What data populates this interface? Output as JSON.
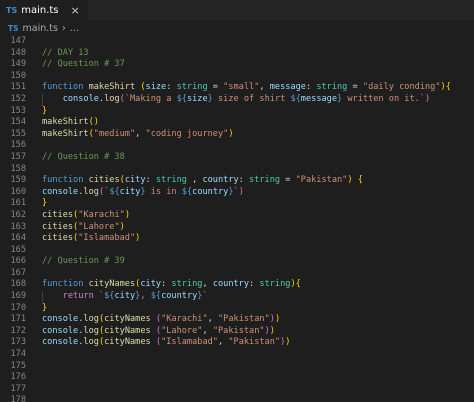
{
  "tab": {
    "icon_text": "TS",
    "filename": "main.ts",
    "close_glyph": "×"
  },
  "breadcrumb": {
    "icon_text": "TS",
    "file": "main.ts",
    "separator": "›",
    "more": "..."
  },
  "colors": {
    "keyword": "#569cd6",
    "function": "#dcdcaa",
    "param": "#9cdcfe",
    "type": "#4ec9b0",
    "string": "#ce9178",
    "comment": "#6a9955",
    "brace_gold": "#ffd700",
    "brace_pink": "#da70d6",
    "brace_blue": "#179fff",
    "plain": "#d4d4d4",
    "control": "#c586c0",
    "punct": "#d4d4d4"
  },
  "lines": [
    {
      "num": "147",
      "tokens": []
    },
    {
      "num": "148",
      "tokens": [
        {
          "t": "// DAY 13",
          "c": "comment"
        }
      ]
    },
    {
      "num": "149",
      "tokens": [
        {
          "t": "// Question # 37",
          "c": "comment"
        }
      ]
    },
    {
      "num": "150",
      "tokens": []
    },
    {
      "num": "151",
      "tokens": [
        {
          "t": "function ",
          "c": "keyword"
        },
        {
          "t": "makeShirt ",
          "c": "function"
        },
        {
          "t": "(",
          "c": "brace_gold"
        },
        {
          "t": "size",
          "c": "param"
        },
        {
          "t": ": ",
          "c": "plain"
        },
        {
          "t": "string",
          "c": "type"
        },
        {
          "t": " = ",
          "c": "plain"
        },
        {
          "t": "\"small\"",
          "c": "string"
        },
        {
          "t": ", ",
          "c": "plain"
        },
        {
          "t": "message",
          "c": "param"
        },
        {
          "t": ": ",
          "c": "plain"
        },
        {
          "t": "string",
          "c": "type"
        },
        {
          "t": " = ",
          "c": "plain"
        },
        {
          "t": "\"daily conding\"",
          "c": "string"
        },
        {
          "t": ")",
          "c": "brace_gold"
        },
        {
          "t": "{",
          "c": "brace_gold"
        }
      ]
    },
    {
      "num": "152",
      "indent": true,
      "tokens": [
        {
          "t": "    console",
          "c": "param"
        },
        {
          "t": ".",
          "c": "plain"
        },
        {
          "t": "log",
          "c": "function"
        },
        {
          "t": "(",
          "c": "brace_pink"
        },
        {
          "t": "`Making a ",
          "c": "string"
        },
        {
          "t": "${",
          "c": "keyword"
        },
        {
          "t": "size",
          "c": "param"
        },
        {
          "t": "}",
          "c": "keyword"
        },
        {
          "t": " size of shirt ",
          "c": "string"
        },
        {
          "t": "${",
          "c": "keyword"
        },
        {
          "t": "message",
          "c": "param"
        },
        {
          "t": "}",
          "c": "keyword"
        },
        {
          "t": " written on it.`",
          "c": "string"
        },
        {
          "t": ")",
          "c": "brace_pink"
        }
      ]
    },
    {
      "num": "153",
      "tokens": [
        {
          "t": "}",
          "c": "brace_gold"
        }
      ]
    },
    {
      "num": "154",
      "tokens": [
        {
          "t": "makeShirt",
          "c": "function"
        },
        {
          "t": "()",
          "c": "brace_gold"
        }
      ]
    },
    {
      "num": "155",
      "tokens": [
        {
          "t": "makeShirt",
          "c": "function"
        },
        {
          "t": "(",
          "c": "brace_gold"
        },
        {
          "t": "\"medium\"",
          "c": "string"
        },
        {
          "t": ", ",
          "c": "plain"
        },
        {
          "t": "\"coding journey\"",
          "c": "string"
        },
        {
          "t": ")",
          "c": "brace_gold"
        }
      ]
    },
    {
      "num": "156",
      "tokens": []
    },
    {
      "num": "157",
      "tokens": [
        {
          "t": "// Question # 38",
          "c": "comment"
        }
      ]
    },
    {
      "num": "158",
      "tokens": []
    },
    {
      "num": "159",
      "tokens": [
        {
          "t": "function ",
          "c": "keyword"
        },
        {
          "t": "cities",
          "c": "function"
        },
        {
          "t": "(",
          "c": "brace_gold"
        },
        {
          "t": "city",
          "c": "param"
        },
        {
          "t": ": ",
          "c": "plain"
        },
        {
          "t": "string",
          "c": "type"
        },
        {
          "t": " , ",
          "c": "plain"
        },
        {
          "t": "country",
          "c": "param"
        },
        {
          "t": ": ",
          "c": "plain"
        },
        {
          "t": "string",
          "c": "type"
        },
        {
          "t": " = ",
          "c": "plain"
        },
        {
          "t": "\"Pakistan\"",
          "c": "string"
        },
        {
          "t": ") ",
          "c": "brace_gold"
        },
        {
          "t": "{",
          "c": "brace_gold"
        }
      ]
    },
    {
      "num": "160",
      "tokens": [
        {
          "t": "console",
          "c": "param"
        },
        {
          "t": ".",
          "c": "plain"
        },
        {
          "t": "log",
          "c": "function"
        },
        {
          "t": "(",
          "c": "brace_pink"
        },
        {
          "t": "`",
          "c": "string"
        },
        {
          "t": "${",
          "c": "keyword"
        },
        {
          "t": "city",
          "c": "param"
        },
        {
          "t": "}",
          "c": "keyword"
        },
        {
          "t": " is in ",
          "c": "string"
        },
        {
          "t": "${",
          "c": "keyword"
        },
        {
          "t": "country",
          "c": "param"
        },
        {
          "t": "}",
          "c": "keyword"
        },
        {
          "t": "`",
          "c": "string"
        },
        {
          "t": ")",
          "c": "brace_pink"
        }
      ]
    },
    {
      "num": "161",
      "tokens": [
        {
          "t": "}",
          "c": "brace_gold"
        }
      ]
    },
    {
      "num": "162",
      "tokens": [
        {
          "t": "cities",
          "c": "function"
        },
        {
          "t": "(",
          "c": "brace_gold"
        },
        {
          "t": "\"Karachi\"",
          "c": "string"
        },
        {
          "t": ")",
          "c": "brace_gold"
        }
      ]
    },
    {
      "num": "163",
      "tokens": [
        {
          "t": "cities",
          "c": "function"
        },
        {
          "t": "(",
          "c": "brace_gold"
        },
        {
          "t": "\"Lahore\"",
          "c": "string"
        },
        {
          "t": ")",
          "c": "brace_gold"
        }
      ]
    },
    {
      "num": "164",
      "tokens": [
        {
          "t": "cities",
          "c": "function"
        },
        {
          "t": "(",
          "c": "brace_gold"
        },
        {
          "t": "\"Islamabad\"",
          "c": "string"
        },
        {
          "t": ")",
          "c": "brace_gold"
        }
      ]
    },
    {
      "num": "165",
      "tokens": []
    },
    {
      "num": "166",
      "tokens": [
        {
          "t": "// Question # 39",
          "c": "comment"
        }
      ]
    },
    {
      "num": "167",
      "tokens": []
    },
    {
      "num": "168",
      "tokens": [
        {
          "t": "function ",
          "c": "keyword"
        },
        {
          "t": "cityNames",
          "c": "function"
        },
        {
          "t": "(",
          "c": "brace_gold"
        },
        {
          "t": "city",
          "c": "param"
        },
        {
          "t": ": ",
          "c": "plain"
        },
        {
          "t": "string",
          "c": "type"
        },
        {
          "t": ", ",
          "c": "plain"
        },
        {
          "t": "country",
          "c": "param"
        },
        {
          "t": ": ",
          "c": "plain"
        },
        {
          "t": "string",
          "c": "type"
        },
        {
          "t": ")",
          "c": "brace_gold"
        },
        {
          "t": "{",
          "c": "brace_gold"
        }
      ]
    },
    {
      "num": "169",
      "indent": true,
      "tokens": [
        {
          "t": "    return ",
          "c": "control"
        },
        {
          "t": "`",
          "c": "string"
        },
        {
          "t": "${",
          "c": "keyword"
        },
        {
          "t": "city",
          "c": "param"
        },
        {
          "t": "}",
          "c": "keyword"
        },
        {
          "t": ", ",
          "c": "string"
        },
        {
          "t": "${",
          "c": "keyword"
        },
        {
          "t": "country",
          "c": "param"
        },
        {
          "t": "}",
          "c": "keyword"
        },
        {
          "t": "`",
          "c": "string"
        }
      ]
    },
    {
      "num": "170",
      "tokens": [
        {
          "t": "}",
          "c": "brace_gold"
        }
      ]
    },
    {
      "num": "171",
      "tokens": [
        {
          "t": "console",
          "c": "param"
        },
        {
          "t": ".",
          "c": "plain"
        },
        {
          "t": "log",
          "c": "function"
        },
        {
          "t": "(",
          "c": "brace_gold"
        },
        {
          "t": "cityNames ",
          "c": "function"
        },
        {
          "t": "(",
          "c": "brace_pink"
        },
        {
          "t": "\"Karachi\"",
          "c": "string"
        },
        {
          "t": ", ",
          "c": "plain"
        },
        {
          "t": "\"Pakistan\"",
          "c": "string"
        },
        {
          "t": ")",
          "c": "brace_pink"
        },
        {
          "t": ")",
          "c": "brace_gold"
        }
      ]
    },
    {
      "num": "172",
      "tokens": [
        {
          "t": "console",
          "c": "param"
        },
        {
          "t": ".",
          "c": "plain"
        },
        {
          "t": "log",
          "c": "function"
        },
        {
          "t": "(",
          "c": "brace_gold"
        },
        {
          "t": "cityNames ",
          "c": "function"
        },
        {
          "t": "(",
          "c": "brace_pink"
        },
        {
          "t": "\"Lahore\"",
          "c": "string"
        },
        {
          "t": ", ",
          "c": "plain"
        },
        {
          "t": "\"Pakistan\"",
          "c": "string"
        },
        {
          "t": ")",
          "c": "brace_pink"
        },
        {
          "t": ")",
          "c": "brace_gold"
        }
      ]
    },
    {
      "num": "173",
      "tokens": [
        {
          "t": "console",
          "c": "param"
        },
        {
          "t": ".",
          "c": "plain"
        },
        {
          "t": "log",
          "c": "function"
        },
        {
          "t": "(",
          "c": "brace_gold"
        },
        {
          "t": "cityNames ",
          "c": "function"
        },
        {
          "t": "(",
          "c": "brace_pink"
        },
        {
          "t": "\"Islamabad\"",
          "c": "string"
        },
        {
          "t": ", ",
          "c": "plain"
        },
        {
          "t": "\"Pakistan\"",
          "c": "string"
        },
        {
          "t": ")",
          "c": "brace_pink"
        },
        {
          "t": ")",
          "c": "brace_gold"
        }
      ]
    },
    {
      "num": "174",
      "tokens": []
    },
    {
      "num": "175",
      "tokens": []
    },
    {
      "num": "176",
      "tokens": []
    },
    {
      "num": "177",
      "tokens": []
    },
    {
      "num": "178",
      "tokens": []
    }
  ]
}
